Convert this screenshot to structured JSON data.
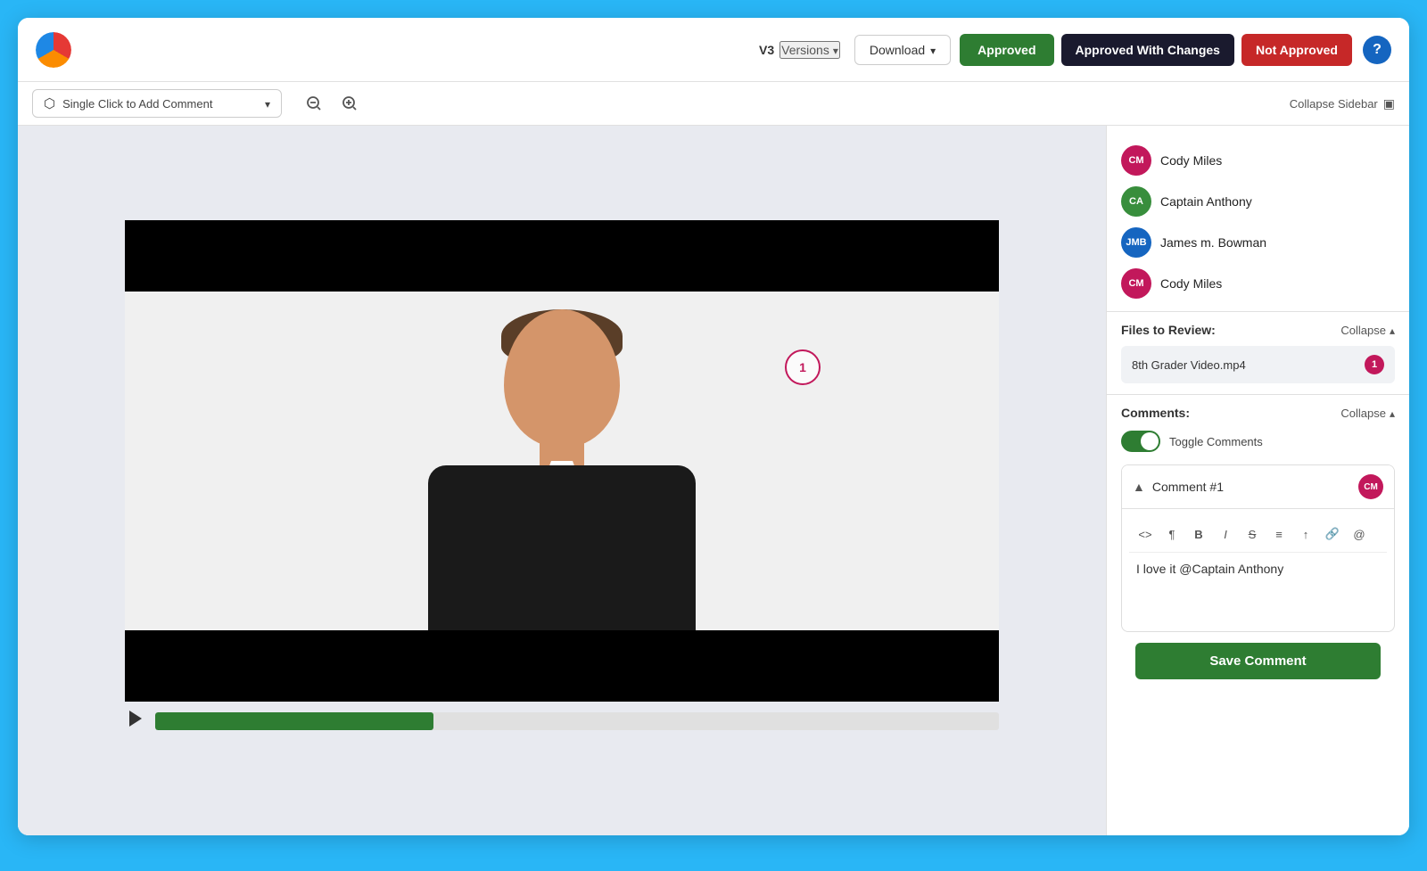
{
  "header": {
    "version_label": "V3",
    "versions_label": "Versions",
    "download_label": "Download",
    "approved_label": "Approved",
    "approved_changes_label": "Approved With Changes",
    "not_approved_label": "Not Approved",
    "help_icon": "?"
  },
  "toolbar": {
    "comment_placeholder": "Single Click to Add Comment",
    "collapse_sidebar_label": "Collapse Sidebar"
  },
  "reviewers": [
    {
      "initials": "CM",
      "name": "Cody Miles",
      "avatar_class": "avatar-cm"
    },
    {
      "initials": "CA",
      "name": "Captain Anthony",
      "avatar_class": "avatar-ca"
    },
    {
      "initials": "JMB",
      "name": "James m. Bowman",
      "avatar_class": "avatar-jmb"
    },
    {
      "initials": "CM",
      "name": "Cody Miles",
      "avatar_class": "avatar-cm"
    }
  ],
  "files_section": {
    "title": "Files to Review:",
    "collapse_label": "Collapse",
    "file_name": "8th Grader Video.mp4",
    "file_badge": "1"
  },
  "comments_section": {
    "title": "Comments:",
    "collapse_label": "Collapse",
    "toggle_label": "Toggle Comments",
    "comment_number": "Comment #1",
    "comment_text": "I love it @Captain Anthony",
    "save_label": "Save Comment"
  },
  "video": {
    "progress_percent": 33,
    "comment_marker": "1"
  }
}
